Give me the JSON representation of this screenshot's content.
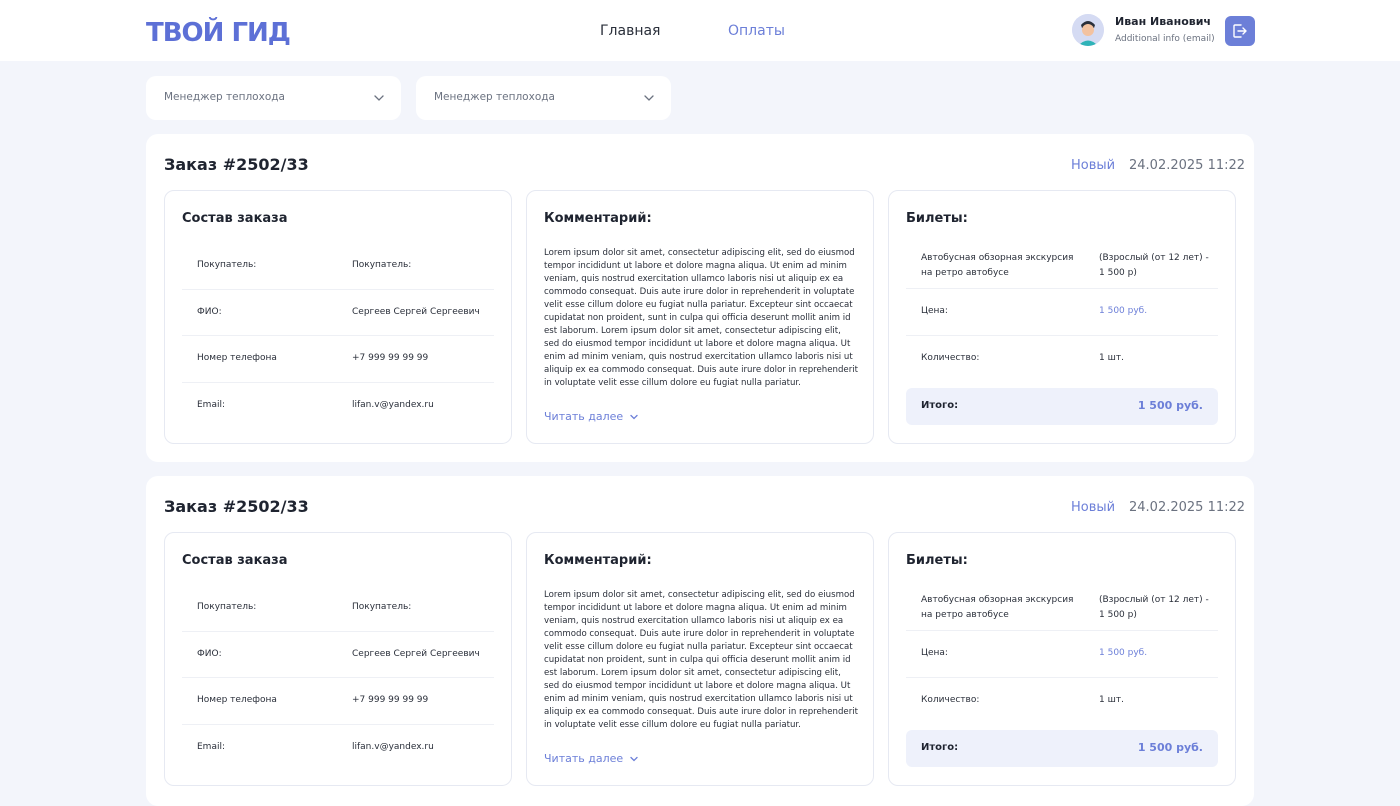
{
  "header": {
    "logo_text": "ТВОЙ ГИД",
    "nav": [
      {
        "label": "Главная"
      },
      {
        "label": "Оплаты"
      }
    ],
    "user": {
      "name": "Иван Иванович",
      "info": "Additional info (email)"
    }
  },
  "filters": [
    {
      "label": "Менеджер теплохода"
    },
    {
      "label": "Менеджер теплохода"
    }
  ],
  "colors": {
    "accent": "#6c7fd8",
    "background": "#f3f5fb"
  },
  "orders": [
    {
      "title": "Заказ #2502/33",
      "status": "Новый",
      "date": "24.02.2025 11:22",
      "composition": {
        "title": "Состав заказа",
        "rows": [
          {
            "label": "Покупатель:",
            "value": "Покупатель:"
          },
          {
            "label": "ФИО:",
            "value": "Сергеев Сергей Сергеевич"
          },
          {
            "label": "Номер телефона",
            "value": "+7 999 99  99 99"
          },
          {
            "label": "Email:",
            "value": "lifan.v@yandex.ru"
          }
        ]
      },
      "comment": {
        "title": "Комментарий:",
        "text": "Lorem ipsum dolor sit amet, consectetur adipiscing elit, sed do eiusmod tempor incididunt ut labore et dolore magna aliqua. Ut enim ad minim veniam, quis nostrud exercitation ullamco laboris nisi ut aliquip ex ea commodo consequat. Duis aute irure dolor in reprehenderit in voluptate velit esse cillum dolore eu fugiat nulla pariatur. Excepteur sint occaecat cupidatat non proident, sunt in culpa qui officia deserunt mollit anim id est laborum. Lorem ipsum dolor sit amet, consectetur adipiscing elit, sed do eiusmod tempor incididunt ut labore et dolore magna aliqua. Ut enim ad minim veniam, quis nostrud exercitation ullamco laboris nisi ut aliquip ex ea commodo consequat. Duis aute irure dolor in reprehenderit in voluptate velit esse cillum dolore eu fugiat nulla pariatur.",
        "read_more": "Читать далее"
      },
      "tickets": {
        "title": "Билеты:",
        "name": "Автобусная обзорная экскурсия на ретро автобусе",
        "type": "(Взрослый (от 12 лет) - 1 500 р)",
        "price_label": "Цена:",
        "price_value": "1 500 руб.",
        "qty_label": "Количество:",
        "qty_value": "1 шт.",
        "total_label": "Итого:",
        "total_value": "1 500 руб."
      }
    },
    {
      "title": "Заказ #2502/33",
      "status": "Новый",
      "date": "24.02.2025 11:22",
      "composition": {
        "title": "Состав заказа",
        "rows": [
          {
            "label": "Покупатель:",
            "value": "Покупатель:"
          },
          {
            "label": "ФИО:",
            "value": "Сергеев Сергей Сергеевич"
          },
          {
            "label": "Номер телефона",
            "value": "+7 999 99  99 99"
          },
          {
            "label": "Email:",
            "value": "lifan.v@yandex.ru"
          }
        ]
      },
      "comment": {
        "title": "Комментарий:",
        "text": "Lorem ipsum dolor sit amet, consectetur adipiscing elit, sed do eiusmod tempor incididunt ut labore et dolore magna aliqua. Ut enim ad minim veniam, quis nostrud exercitation ullamco laboris nisi ut aliquip ex ea commodo consequat. Duis aute irure dolor in reprehenderit in voluptate velit esse cillum dolore eu fugiat nulla pariatur. Excepteur sint occaecat cupidatat non proident, sunt in culpa qui officia deserunt mollit anim id est laborum. Lorem ipsum dolor sit amet, consectetur adipiscing elit, sed do eiusmod tempor incididunt ut labore et dolore magna aliqua. Ut enim ad minim veniam, quis nostrud exercitation ullamco laboris nisi ut aliquip ex ea commodo consequat. Duis aute irure dolor in reprehenderit in voluptate velit esse cillum dolore eu fugiat nulla pariatur.",
        "read_more": "Читать далее"
      },
      "tickets": {
        "title": "Билеты:",
        "name": "Автобусная обзорная экскурсия на ретро автобусе",
        "type": "(Взрослый (от 12 лет) - 1 500 р)",
        "price_label": "Цена:",
        "price_value": "1 500 руб.",
        "qty_label": "Количество:",
        "qty_value": "1 шт.",
        "total_label": "Итого:",
        "total_value": "1 500 руб."
      }
    }
  ]
}
